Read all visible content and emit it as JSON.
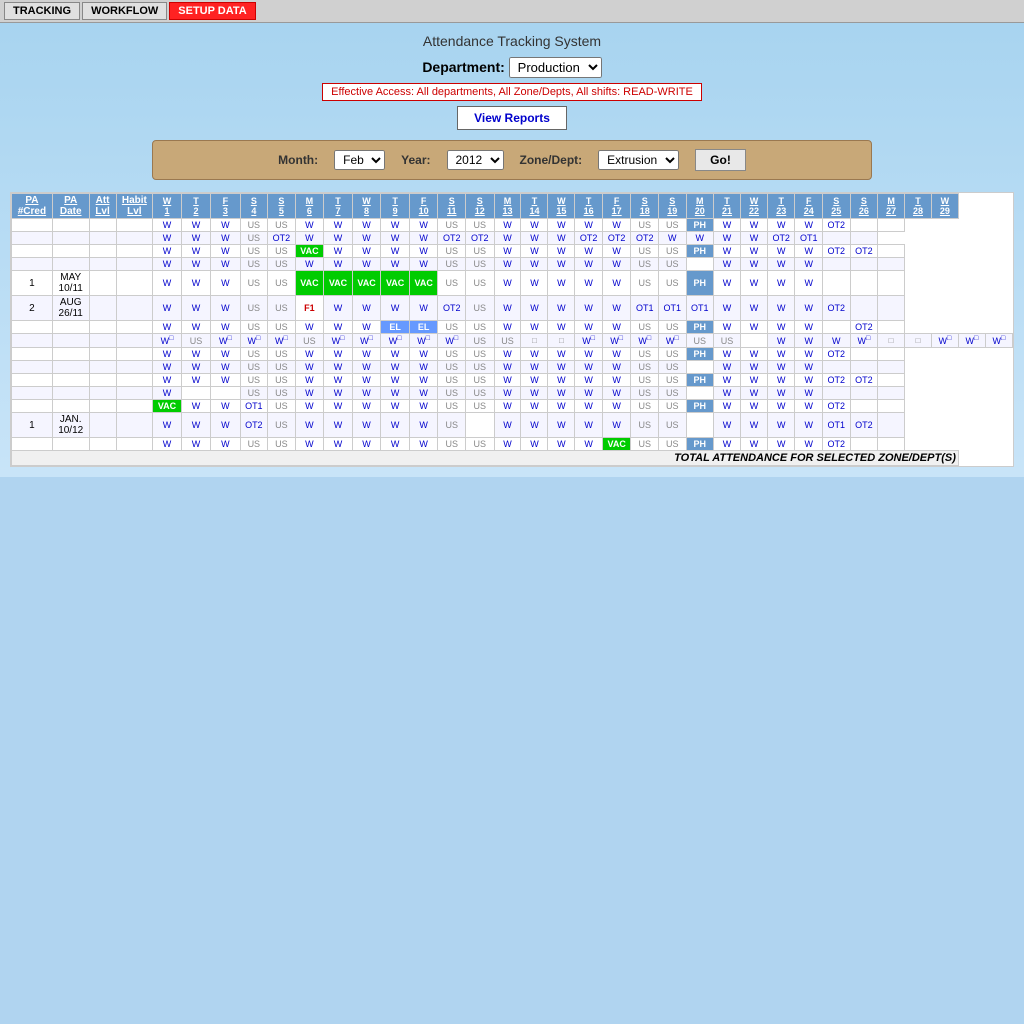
{
  "nav": {
    "items": [
      {
        "label": "TRACKING",
        "active": false
      },
      {
        "label": "WORKFLOW",
        "active": false
      },
      {
        "label": "SETUP DATA",
        "active": true
      }
    ]
  },
  "header": {
    "title": "Attendance Tracking System",
    "dept_label": "Department:",
    "dept_value": "Production",
    "access_notice": "Effective Access: All departments, All Zone/Depts, All shifts: READ-WRITE",
    "view_reports": "View Reports"
  },
  "filters": {
    "month_label": "Month:",
    "month_value": "Feb",
    "year_label": "Year:",
    "year_value": "2012",
    "zone_label": "Zone/Dept:",
    "zone_value": "Extrusion",
    "go_label": "Go!"
  },
  "columns": {
    "fixed": [
      "PA\n# Cred",
      "PA\nDate",
      "Att\nLvl",
      "Habit\nLvl"
    ],
    "days": [
      "W\n1",
      "T\n2",
      "F\n3",
      "S\n4",
      "S\n5",
      "M\n6",
      "T\n7",
      "W\n8",
      "T\n9",
      "F\n10",
      "S\n11",
      "S\n12",
      "M\n13",
      "T\n14",
      "W\n15",
      "T\n16",
      "F\n17",
      "S\n18",
      "S\n19",
      "M\n20",
      "T\n21",
      "W\n22",
      "T\n23",
      "F\n24",
      "S\n25",
      "S\n26",
      "M\n27",
      "T\n28",
      "W\n29"
    ]
  },
  "footer": {
    "text": "TOTAL ATTENDANCE FOR SELECTED ZONE/DEPT(S)"
  }
}
